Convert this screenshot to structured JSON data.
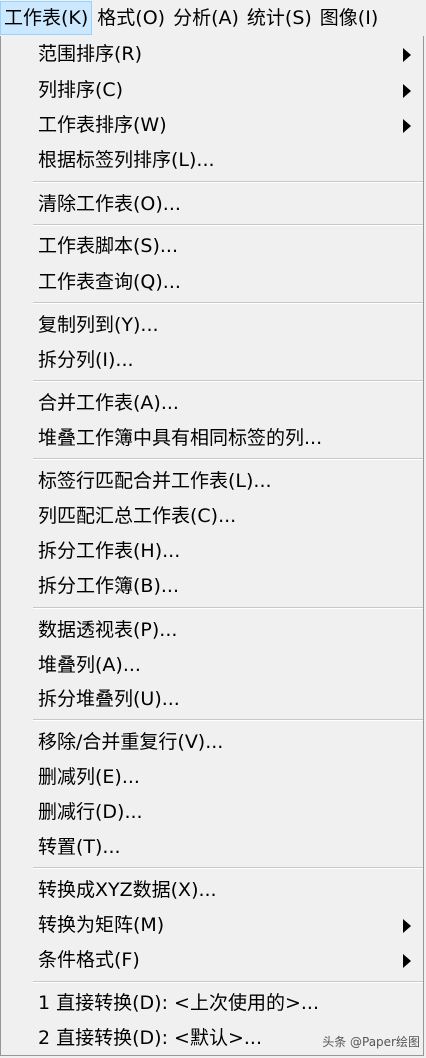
{
  "menubar": {
    "items": [
      {
        "label": "工作表(K)"
      },
      {
        "label": "格式(O)"
      },
      {
        "label": "分析(A)"
      },
      {
        "label": "统计(S)"
      },
      {
        "label": "图像(I)"
      }
    ]
  },
  "menu": {
    "items": [
      {
        "label": "范围排序(R)",
        "submenu": true
      },
      {
        "label": "列排序(C)",
        "submenu": true
      },
      {
        "label": "工作表排序(W)",
        "submenu": true
      },
      {
        "label": "根据标签列排序(L)..."
      },
      {
        "label": "清除工作表(O)..."
      },
      {
        "label": "工作表脚本(S)..."
      },
      {
        "label": "工作表查询(Q)..."
      },
      {
        "label": "复制列到(Y)..."
      },
      {
        "label": "拆分列(I)..."
      },
      {
        "label": "合并工作表(A)..."
      },
      {
        "label": "堆叠工作簿中具有相同标签的列..."
      },
      {
        "label": "标签行匹配合并工作表(L)..."
      },
      {
        "label": "列匹配汇总工作表(C)..."
      },
      {
        "label": "拆分工作表(H)..."
      },
      {
        "label": "拆分工作簿(B)..."
      },
      {
        "label": "数据透视表(P)..."
      },
      {
        "label": "堆叠列(A)..."
      },
      {
        "label": "拆分堆叠列(U)..."
      },
      {
        "label": "移除/合并重复行(V)..."
      },
      {
        "label": "删减列(E)..."
      },
      {
        "label": "删减行(D)..."
      },
      {
        "label": "转置(T)..."
      },
      {
        "label": "转换成XYZ数据(X)..."
      },
      {
        "label": "转换为矩阵(M)",
        "submenu": true
      },
      {
        "label": "条件格式(F)",
        "submenu": true
      },
      {
        "label": "1 直接转换(D): <上次使用的>..."
      },
      {
        "label": "2 直接转换(D): <默认>..."
      }
    ]
  },
  "watermark": "头条 @Paper绘图"
}
